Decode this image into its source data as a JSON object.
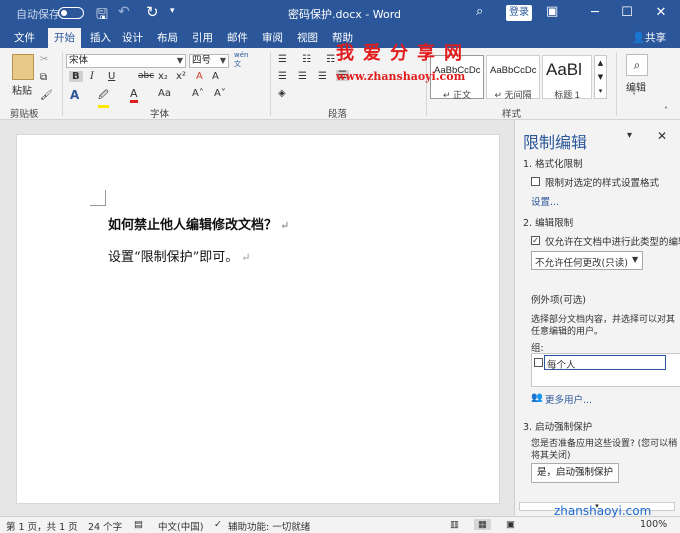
{
  "titlebar": {
    "autosave_label": "自动保存",
    "autosave_state": "关",
    "document_title": "密码保护.docx - Word",
    "login_label": "登录",
    "bg_color": "#2b579a"
  },
  "tabs": [
    "文件",
    "开始",
    "插入",
    "设计",
    "布局",
    "引用",
    "邮件",
    "审阅",
    "视图",
    "帮助"
  ],
  "active_tab": "开始",
  "share_label": "共享",
  "ribbon": {
    "clipboard": {
      "paste_label": "粘贴",
      "group_label": "剪贴板"
    },
    "font": {
      "font_name": "宋体",
      "font_size": "四号",
      "wen_label": "wén",
      "wen_char": "文",
      "bold": "B",
      "italic": "I",
      "underline": "U",
      "strike": "abc",
      "subscript": "x₂",
      "superscript": "x²",
      "clear": "A",
      "case": "Aa",
      "grow": "A˄",
      "shrink": "A˅",
      "char_border": "A",
      "group_label": "字体"
    },
    "paragraph": {
      "group_label": "段落"
    },
    "styles": {
      "items": [
        {
          "sample": "AaBbCcDc",
          "name": "↵ 正文"
        },
        {
          "sample": "AaBbCcDc",
          "name": "↵ 无间隔"
        },
        {
          "sample": "AaBl",
          "name": "标题 1"
        }
      ],
      "group_label": "样式"
    },
    "editing": {
      "label": "编辑"
    }
  },
  "watermark": {
    "line1": "我爱分享网",
    "line2": "www.zhanshaoyi.com",
    "line3": "zhanshaoyi.com"
  },
  "document": {
    "line1": "如何禁止他人编辑修改文档？",
    "line2": "设置“限制保护”即可。",
    "paragraph_mark": "↵"
  },
  "pane": {
    "title": "限制编辑",
    "section1_title": "1. 格式化限制",
    "section1_check": "限制对选定的样式设置格式",
    "settings_link": "设置...",
    "section2_title": "2. 编辑限制",
    "section2_check": "仅允许在文档中进行此类型的编辑",
    "section2_check_checked": true,
    "edit_type": "不允许任何更改(只读)",
    "exceptions_title": "例外项(可选)",
    "exceptions_desc1": "选择部分文档内容，并选择可以对其",
    "exceptions_desc2": "任意编辑的用户。",
    "group_label": "组:",
    "group_item": "每个人",
    "more_users": "更多用户...",
    "section3_title": "3. 启动强制保护",
    "section3_desc1": "您是否准备应用这些设置? (您可以稍",
    "section3_desc2": "将其关闭)",
    "enforce_button": "是，启动强制保护"
  },
  "status": {
    "page": "第 1 页，共 1 页",
    "words": "24 个字",
    "language": "中文(中国)",
    "accessibility": "辅助功能: 一切就绪",
    "zoom": "100%"
  }
}
